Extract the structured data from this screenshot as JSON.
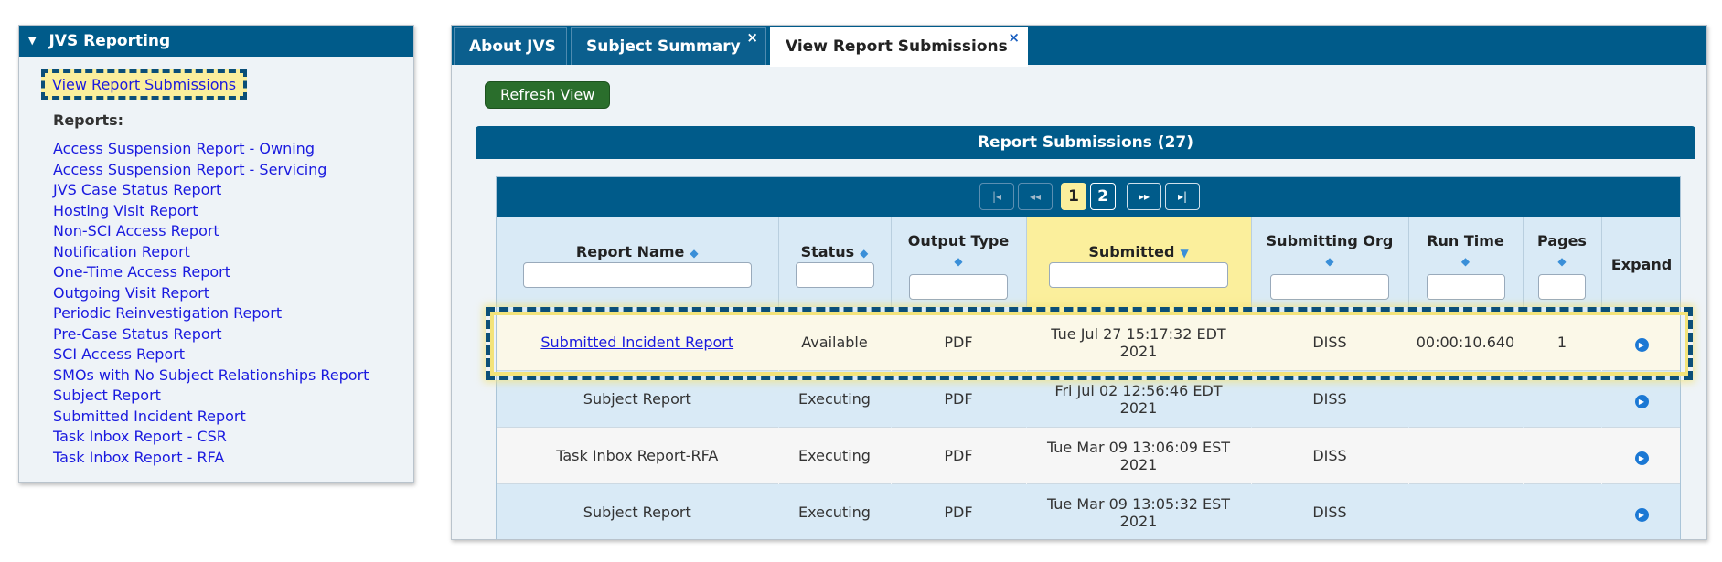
{
  "left_panel": {
    "title": "JVS Reporting",
    "view_submissions_link": "View Report Submissions",
    "reports_label": "Reports:",
    "reports": [
      "Access Suspension Report - Owning",
      "Access Suspension Report - Servicing",
      "JVS Case Status Report",
      "Hosting Visit Report",
      "Non-SCI Access Report",
      "Notification Report",
      "One-Time Access Report",
      "Outgoing Visit Report",
      "Periodic Reinvestigation Report",
      "Pre-Case Status Report",
      "SCI Access Report",
      "SMOs with No Subject Relationships Report",
      "Subject Report",
      "Submitted Incident Report",
      "Task Inbox Report - CSR",
      "Task Inbox Report - RFA"
    ]
  },
  "tabs": [
    {
      "label": "About JVS",
      "closable": false
    },
    {
      "label": "Subject Summary",
      "closable": true
    },
    {
      "label": "View Report Submissions",
      "closable": true,
      "active": true
    }
  ],
  "close_glyph": "×",
  "refresh_label": "Refresh View",
  "section_title": "Report Submissions (27)",
  "pager": {
    "first": "|◂",
    "prev": "◂◂",
    "pages": [
      "1",
      "2"
    ],
    "current": "1",
    "next": "▸▸",
    "last": "▸|"
  },
  "table": {
    "columns": [
      {
        "label": "Report Name",
        "sortable": true
      },
      {
        "label": "Status",
        "sortable": true
      },
      {
        "label": "Output Type",
        "sortable": true
      },
      {
        "label": "Submitted",
        "sortable": true,
        "sorted": "desc"
      },
      {
        "label": "Submitting Org",
        "sortable": true
      },
      {
        "label": "Run Time",
        "sortable": true
      },
      {
        "label": "Pages",
        "sortable": true
      },
      {
        "label": "Expand",
        "sortable": false
      }
    ],
    "rows": [
      {
        "name": "Submitted Incident Report",
        "status": "Available",
        "output": "PDF",
        "submitted_line1": "Tue Jul 27 15:17:32 EDT",
        "submitted_line2": "2021",
        "org": "DISS",
        "run_time": "00:00:10.640",
        "pages": "1",
        "link": true
      },
      {
        "name": "Subject Report",
        "status": "Executing",
        "output": "PDF",
        "submitted_line1": "Fri Jul 02 12:56:46 EDT",
        "submitted_line2": "2021",
        "org": "DISS",
        "run_time": "",
        "pages": ""
      },
      {
        "name": "Task Inbox Report-RFA",
        "status": "Executing",
        "output": "PDF",
        "submitted_line1": "Tue Mar 09 13:06:09 EST",
        "submitted_line2": "2021",
        "org": "DISS",
        "run_time": "",
        "pages": ""
      },
      {
        "name": "Subject Report",
        "status": "Executing",
        "output": "PDF",
        "submitted_line1": "Tue Mar 09 13:05:32 EST",
        "submitted_line2": "2021",
        "org": "DISS",
        "run_time": "",
        "pages": ""
      }
    ]
  },
  "colors": {
    "brand_blue": "#005b8a",
    "highlight_yellow": "#fbef9c",
    "link_blue": "#1a1adf",
    "refresh_green": "#2a6e2c"
  }
}
